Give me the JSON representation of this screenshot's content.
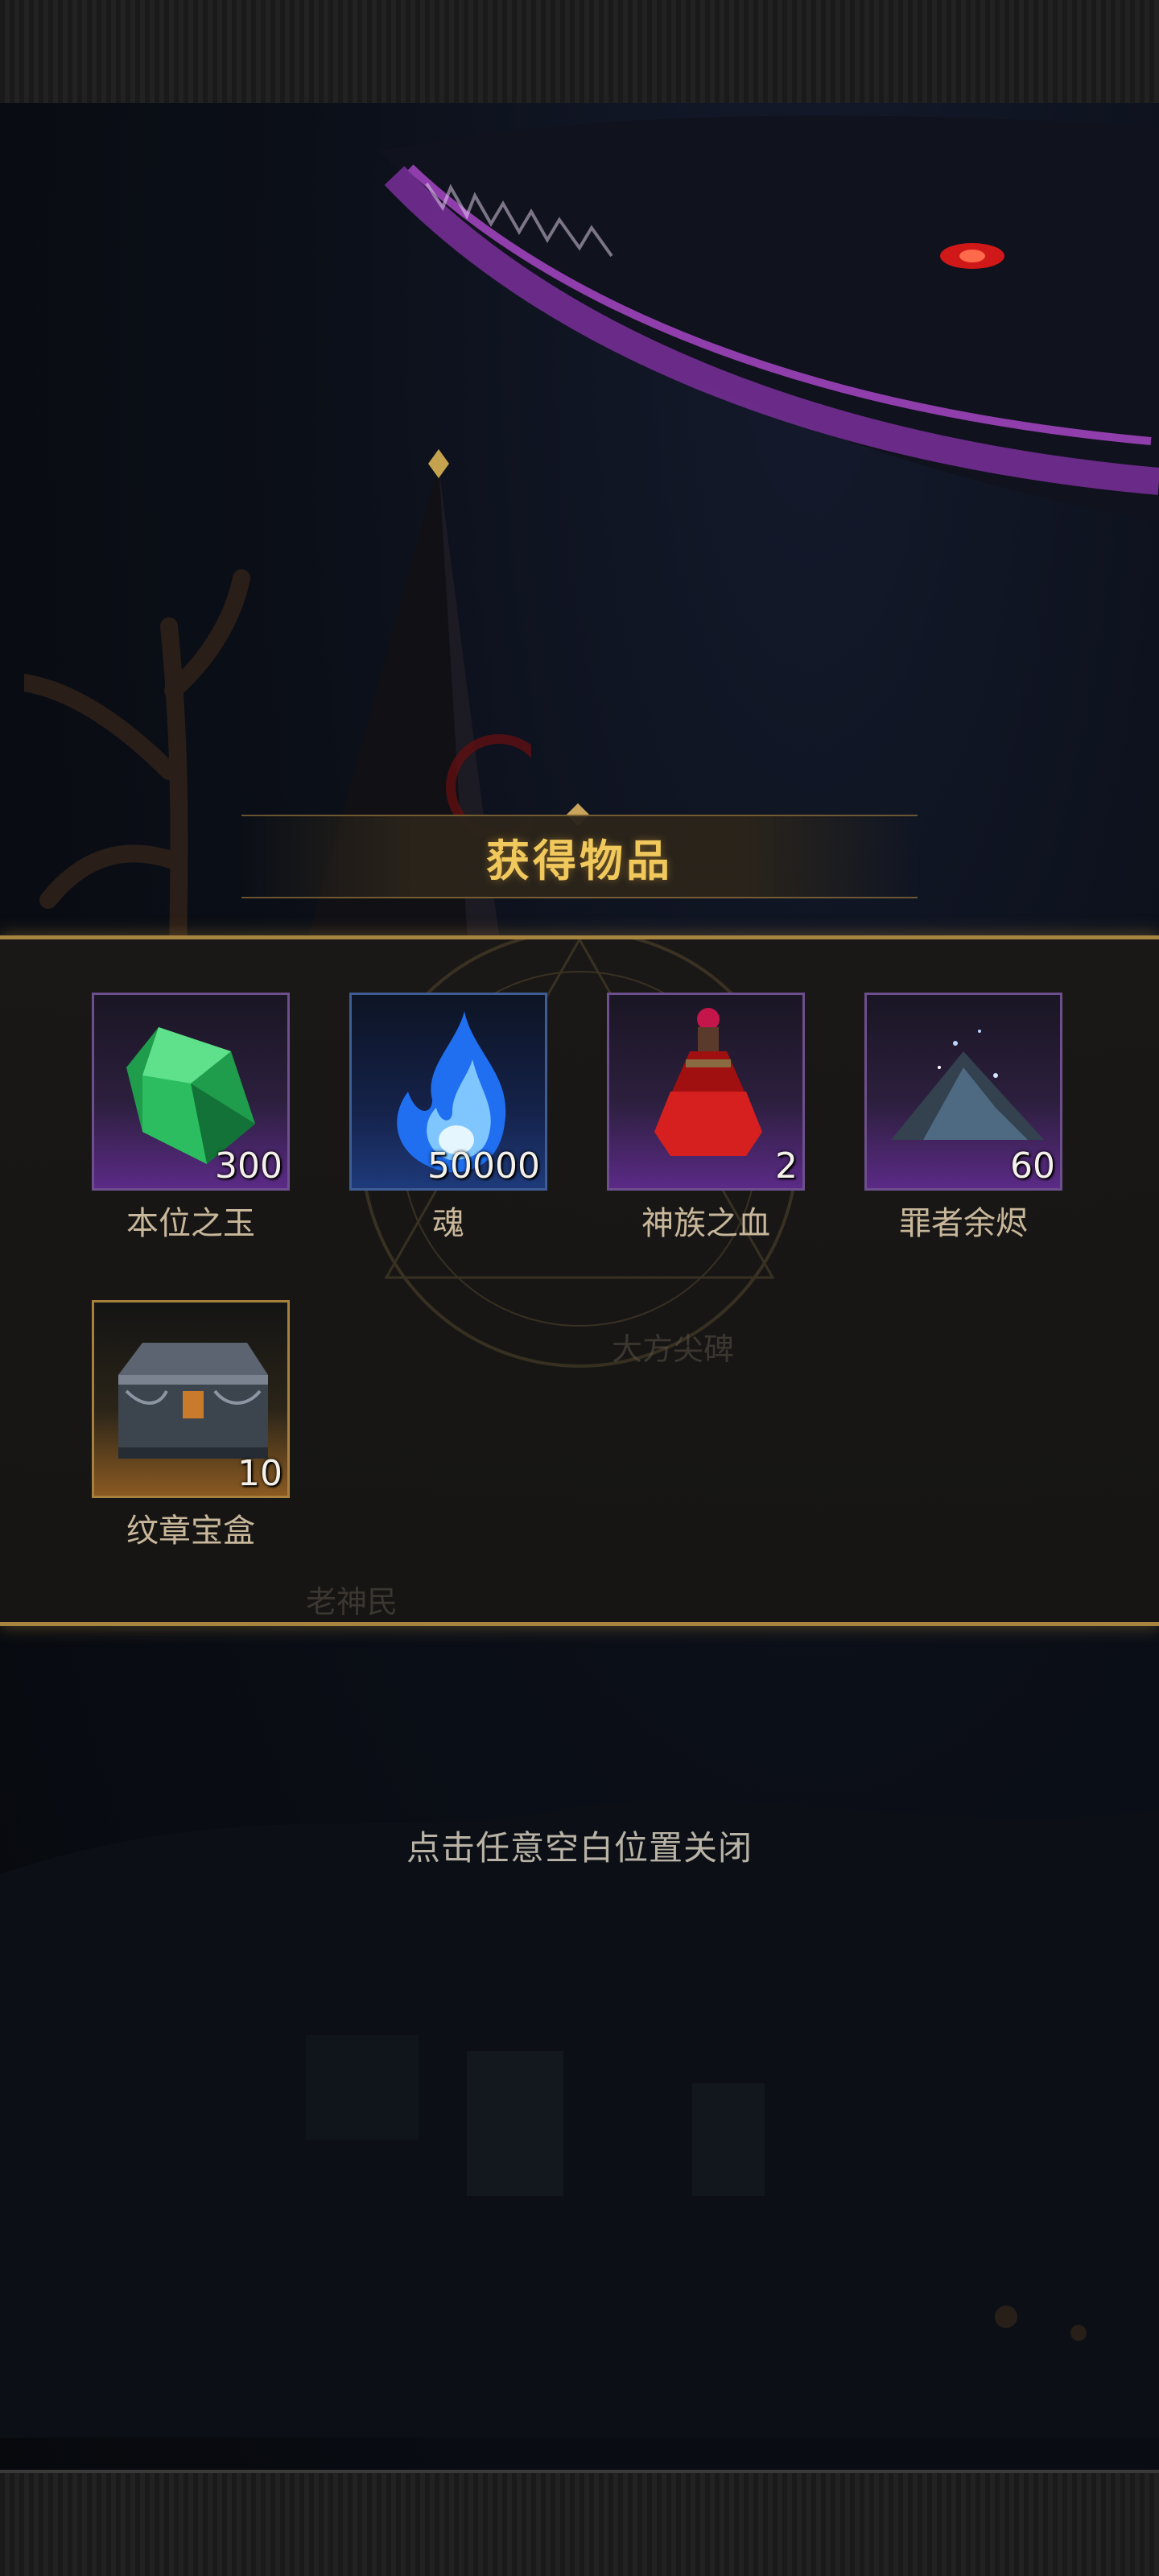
{
  "dialog": {
    "title": "获得物品",
    "close_hint": "点击任意空白位置关闭"
  },
  "items": [
    {
      "name": "本位之玉",
      "count": "300",
      "icon": "green-jade-icon",
      "rarity": "epic"
    },
    {
      "name": "魂",
      "count": "50000",
      "icon": "blue-soul-flame-icon",
      "rarity": "rare"
    },
    {
      "name": "神族之血",
      "count": "2",
      "icon": "red-blood-flask-icon",
      "rarity": "epic"
    },
    {
      "name": "罪者余烬",
      "count": "60",
      "icon": "ash-pile-icon",
      "rarity": "epic"
    },
    {
      "name": "纹章宝盒",
      "count": "10",
      "icon": "ornate-chest-icon",
      "rarity": "legendary"
    }
  ],
  "background_labels": {
    "map_label_1": "大方尖碑",
    "map_label_2": "老神民"
  },
  "colors": {
    "title": "#f0c85c",
    "panel_border": "#a88441",
    "epic_frame": "#6e4f8d",
    "rare_frame": "#3f5d94",
    "legendary_frame": "#a6803c"
  }
}
